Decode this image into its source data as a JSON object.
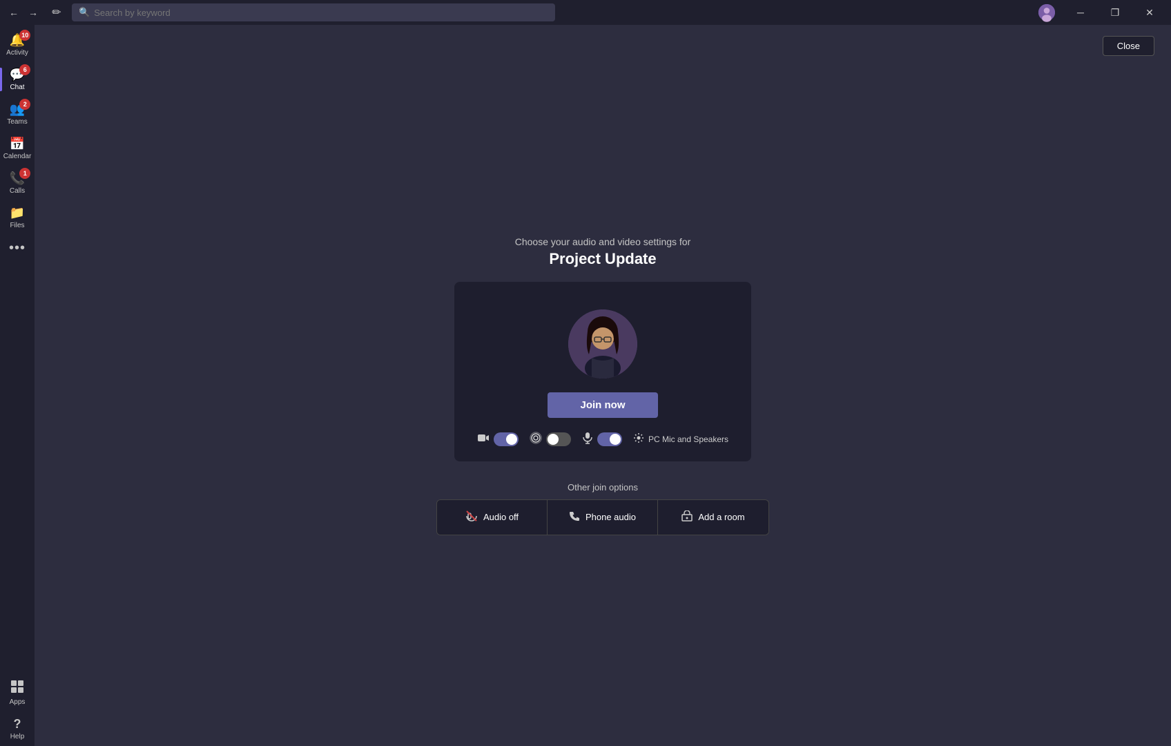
{
  "titlebar": {
    "search_placeholder": "Search by keyword",
    "back_label": "←",
    "forward_label": "→",
    "compose_label": "✏",
    "minimize_label": "─",
    "restore_label": "❐",
    "close_label": "✕"
  },
  "sidebar": {
    "items": [
      {
        "id": "activity",
        "label": "Activity",
        "icon": "🔔",
        "badge": "10"
      },
      {
        "id": "chat",
        "label": "Chat",
        "icon": "💬",
        "badge": "6"
      },
      {
        "id": "teams",
        "label": "Teams",
        "icon": "👥",
        "badge": "2"
      },
      {
        "id": "calendar",
        "label": "Calendar",
        "icon": "📅",
        "badge": ""
      },
      {
        "id": "calls",
        "label": "Calls",
        "icon": "📞",
        "badge": "1"
      },
      {
        "id": "files",
        "label": "Files",
        "icon": "📁",
        "badge": ""
      },
      {
        "id": "more",
        "label": "...",
        "icon": "•••",
        "badge": ""
      }
    ],
    "bottom_items": [
      {
        "id": "apps",
        "label": "Apps",
        "icon": "⊞",
        "badge": ""
      },
      {
        "id": "help",
        "label": "Help",
        "icon": "?",
        "badge": ""
      }
    ]
  },
  "main": {
    "close_button": "Close",
    "meeting": {
      "subtitle": "Choose your audio and video settings for",
      "title": "Project Update"
    },
    "controls": {
      "video_icon": "🎥",
      "blur_icon": "⊞",
      "mic_icon": "🎤",
      "audio_label": "PC Mic and Speakers",
      "video_toggle": "on",
      "blur_toggle": "off",
      "mic_toggle": "on"
    },
    "join_button": "Join now",
    "other_options": {
      "label": "Other join options",
      "buttons": [
        {
          "id": "audio-off",
          "icon": "🔇",
          "label": "Audio off"
        },
        {
          "id": "phone-audio",
          "icon": "📱",
          "label": "Phone audio"
        },
        {
          "id": "add-room",
          "icon": "🏠",
          "label": "Add a room"
        }
      ]
    }
  }
}
